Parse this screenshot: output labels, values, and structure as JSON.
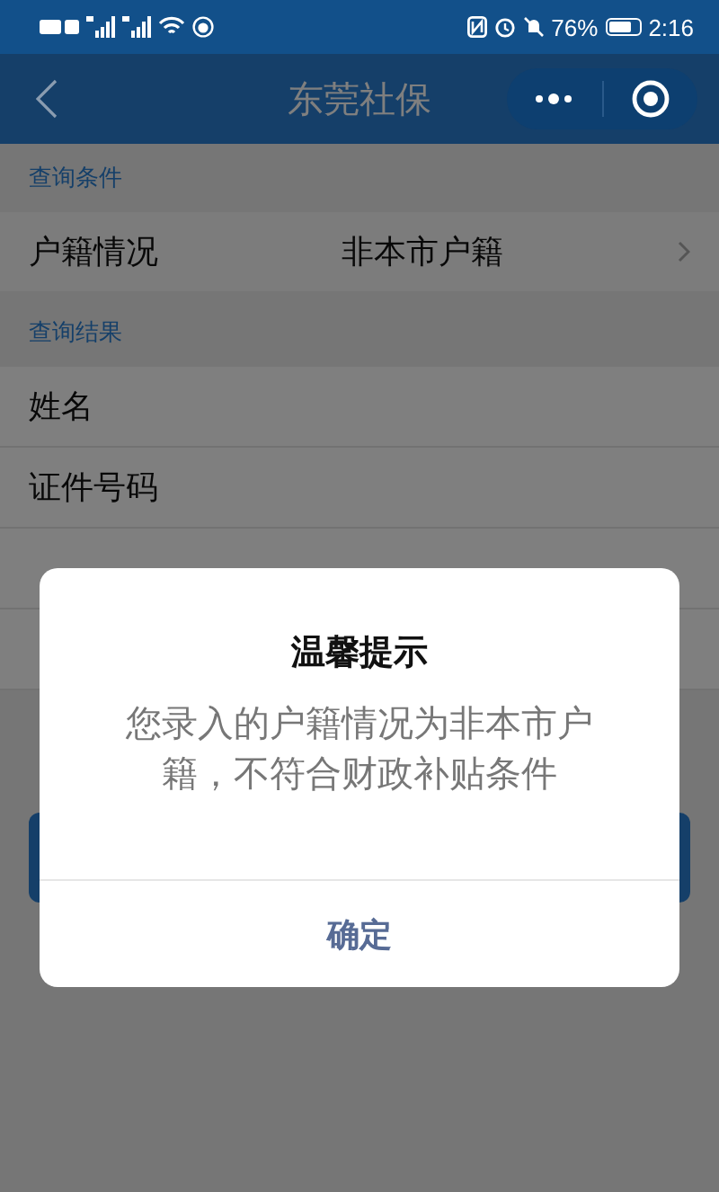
{
  "status_bar": {
    "battery": "76%",
    "time": "2:16"
  },
  "nav": {
    "title": "东莞社保"
  },
  "sections": [
    {
      "title": "查询条件",
      "rows": [
        {
          "label": "户籍情况",
          "value": "非本市户籍",
          "kind": "picker"
        }
      ]
    },
    {
      "title": "查询结果",
      "rows": [
        {
          "label": "姓名",
          "kind": "field"
        },
        {
          "label": "证件号码",
          "kind": "field"
        },
        {
          "kind": "field"
        },
        {
          "kind": "field"
        }
      ]
    }
  ],
  "dialog": {
    "title": "温馨提示",
    "message": "您录入的户籍情况为非本市户籍，不符合财政补贴条件",
    "button": "确定"
  }
}
